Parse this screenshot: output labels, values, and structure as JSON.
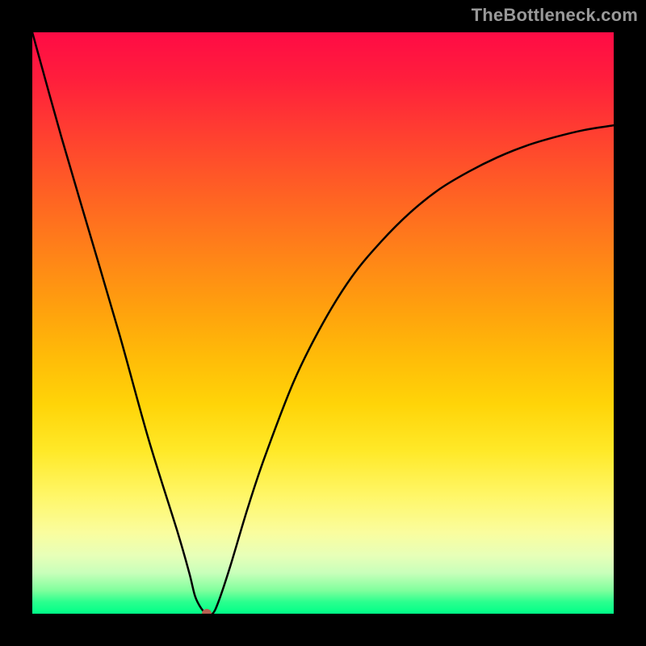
{
  "watermark": "TheBottleneck.com",
  "chart_data": {
    "type": "line",
    "title": "",
    "xlabel": "",
    "ylabel": "",
    "x_range": [
      0,
      100
    ],
    "y_range_percent": [
      0,
      100
    ],
    "curve_points": [
      {
        "x": 0,
        "y": 100
      },
      {
        "x": 5,
        "y": 82
      },
      {
        "x": 10,
        "y": 65
      },
      {
        "x": 15,
        "y": 48
      },
      {
        "x": 20,
        "y": 30
      },
      {
        "x": 25,
        "y": 14
      },
      {
        "x": 27,
        "y": 7
      },
      {
        "x": 28,
        "y": 3
      },
      {
        "x": 29,
        "y": 1
      },
      {
        "x": 30,
        "y": 0
      },
      {
        "x": 31,
        "y": 0
      },
      {
        "x": 32,
        "y": 2
      },
      {
        "x": 34,
        "y": 8
      },
      {
        "x": 37,
        "y": 18
      },
      {
        "x": 40,
        "y": 27
      },
      {
        "x": 45,
        "y": 40
      },
      {
        "x": 50,
        "y": 50
      },
      {
        "x": 55,
        "y": 58
      },
      {
        "x": 60,
        "y": 64
      },
      {
        "x": 65,
        "y": 69
      },
      {
        "x": 70,
        "y": 73
      },
      {
        "x": 75,
        "y": 76
      },
      {
        "x": 80,
        "y": 78.5
      },
      {
        "x": 85,
        "y": 80.5
      },
      {
        "x": 90,
        "y": 82
      },
      {
        "x": 95,
        "y": 83.2
      },
      {
        "x": 100,
        "y": 84
      }
    ],
    "marker": {
      "x": 30,
      "y": 0
    },
    "colors": {
      "gradient_top": "#ff0b45",
      "gradient_bottom": "#00ff88",
      "curve": "#000000",
      "marker": "#b76052"
    }
  }
}
